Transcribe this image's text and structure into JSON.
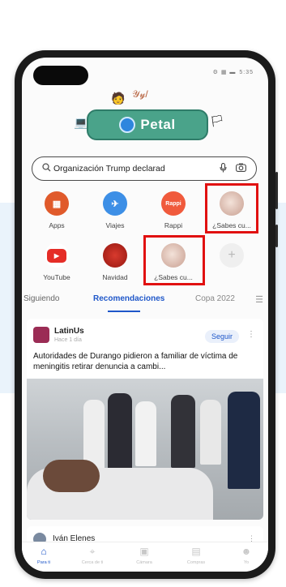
{
  "status": {
    "icons": "⚙ ▦ ▬",
    "time": "5:35"
  },
  "logo": {
    "text": "Petal"
  },
  "search": {
    "query": "Organización Trump declarad"
  },
  "shortcuts": [
    {
      "label": "Apps",
      "color": "#e05a2b",
      "icon_text": "▦",
      "icon": "apps-icon"
    },
    {
      "label": "Viajes",
      "color": "#3d8fe6",
      "icon_text": "✈",
      "icon": "plane-icon"
    },
    {
      "label": "Rappi",
      "color": "#f05a3c",
      "icon_text": "Rappi",
      "icon": "rappi-logo"
    },
    {
      "label": "¿Sabes cu...",
      "color": "#e8d6d0",
      "icon_text": "",
      "icon": "quiz-face-icon"
    },
    {
      "label": "YouTube",
      "color": "#e52d27",
      "icon_text": "▶",
      "icon": "youtube-icon"
    },
    {
      "label": "Navidad",
      "color": "#b3261e",
      "icon_text": "",
      "icon": "christmas-icon"
    },
    {
      "label": "¿Sabes cu...",
      "color": "#e8d6d0",
      "icon_text": "",
      "icon": "quiz-face-icon"
    },
    {
      "label": "",
      "color": "#efefef",
      "icon_text": "+",
      "icon": "add-icon"
    }
  ],
  "tabs": [
    {
      "label": "Siguiendo",
      "active": false
    },
    {
      "label": "Recomendaciones",
      "active": true
    },
    {
      "label": "Copa 2022",
      "active": false
    }
  ],
  "card": {
    "source": "LatinUs",
    "time": "Hace 1 día",
    "follow": "Seguir",
    "headline": "Autoridades de Durango pidieron a familiar de víctima de meningitis retirar denuncia a cambi..."
  },
  "card2": {
    "name": "Iván Elenes"
  },
  "nav": [
    {
      "label": "Para ti",
      "active": true,
      "icon": "home-icon",
      "glyph": "⌂"
    },
    {
      "label": "Cerca de ti",
      "active": false,
      "icon": "location-icon",
      "glyph": "⌖"
    },
    {
      "label": "Cámara",
      "active": false,
      "icon": "camera-icon",
      "glyph": "▣"
    },
    {
      "label": "Compras",
      "active": false,
      "icon": "shopping-icon",
      "glyph": "▤"
    },
    {
      "label": "Yo",
      "active": false,
      "icon": "profile-icon",
      "glyph": "☻"
    }
  ],
  "colors": {
    "accent": "#1f57c9",
    "highlight": "#e11010",
    "logo_green": "#4aa38a"
  }
}
